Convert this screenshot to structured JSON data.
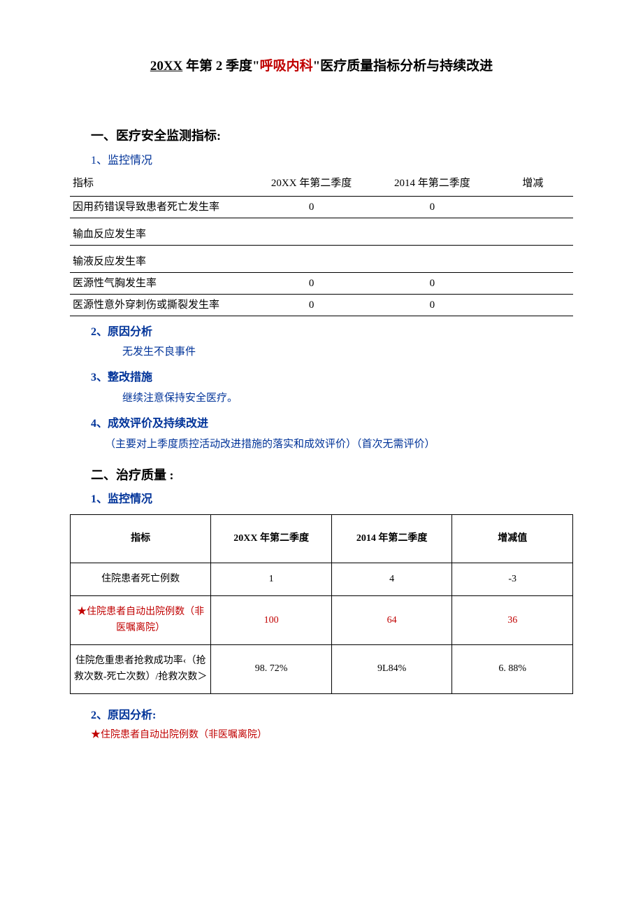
{
  "title": {
    "prefix_underline": "20XX",
    "mid1": " 年第 2 季度\"",
    "red": "呼吸内科",
    "mid2": "\"医疗质量指标分析与持续改进"
  },
  "section1": {
    "heading": "一、医疗安全监测指标:",
    "sub1": "1、监控情况",
    "table_headers": [
      "指标",
      "20XX 年第二季度",
      "2014 年第二季度",
      "增减"
    ],
    "rows": [
      {
        "label": "因用药错误导致患者死亡发生率",
        "c1": "0",
        "c2": "0",
        "c3": ""
      },
      {
        "label": "输血反应发生率",
        "c1": "",
        "c2": "",
        "c3": "",
        "tall": true
      },
      {
        "label": "输液反应发生率",
        "c1": "",
        "c2": "",
        "c3": "",
        "tall": true
      },
      {
        "label": "医源性气胸发生率",
        "c1": "0",
        "c2": "0",
        "c3": ""
      },
      {
        "label": "医源性意外穿刺伤或撕裂发生率",
        "c1": "0",
        "c2": "0",
        "c3": ""
      }
    ],
    "sub2": "2、原因分析",
    "text2": "无发生不良事件",
    "sub3": "3、整改措施",
    "text3": "继续注意保持安全医疗。",
    "sub4": "4、成效评价及持续改进",
    "text4": "（主要对上季度质控活动改进措施的落实和成效评价）（首次无需评价）"
  },
  "section2": {
    "heading": "二、治疗质量 :",
    "sub1": "1、监控情况",
    "table_headers": [
      "指标",
      "20XX 年第二季度",
      "2014 年第二季度",
      "增减值"
    ],
    "rows": [
      {
        "label": "住院患者死亡例数",
        "c1": "1",
        "c2": "4",
        "c3": "-3",
        "red": false
      },
      {
        "label": "★住院患者自动出院例数（非医嘱离院）",
        "c1": "100",
        "c2": "64",
        "c3": "36",
        "red": true
      },
      {
        "label": "住院危重患者抢救成功率‹（抢救次数-死亡次数）/抢救次数＞",
        "c1": "98. 72%",
        "c2": "9L84%",
        "c3": "6. 88%",
        "red": false
      }
    ],
    "sub2": "2、原因分析:",
    "text2": "★住院患者自动出院例数（非医嘱离院）"
  }
}
